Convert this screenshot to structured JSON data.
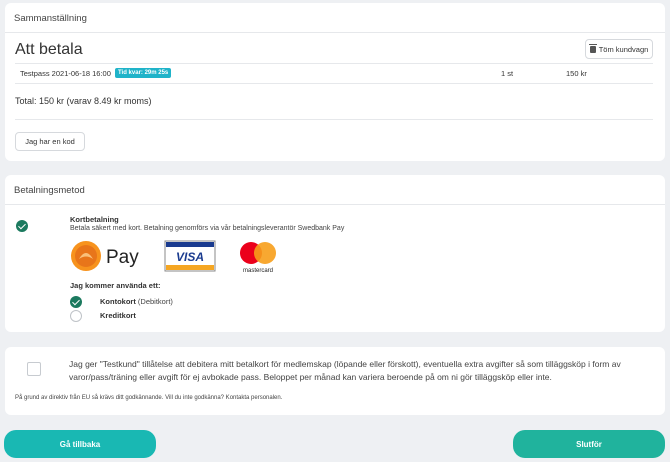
{
  "summary": {
    "header": "Sammanställning",
    "title": "Att betala",
    "clear_cart_label": "Töm kundvagn",
    "item": {
      "name": "Testpass 2021-06-18 16:00",
      "time_left_badge": "Tid kvar: 29m 25s",
      "quantity": "1 st",
      "price": "150 kr"
    },
    "total": "Total: 150 kr (varav 8.49 kr moms)",
    "code_button_label": "Jag har en kod"
  },
  "payment": {
    "header": "Betalningsmetod",
    "method_title": "Kortbetalning",
    "method_description": "Betala säkert med kort. Betalning genomförs via vår betalningsleverantör Swedbank Pay",
    "logos": {
      "swedbank_pay": "Pay",
      "visa": "VISA",
      "mastercard": "mastercard"
    },
    "will_use_label": "Jag kommer använda ett:",
    "options": [
      {
        "label": "Kontokort",
        "sublabel": "(Debitkort)",
        "selected": true
      },
      {
        "label": "Kreditkort",
        "sublabel": "",
        "selected": false
      }
    ]
  },
  "consent": {
    "text": "Jag ger \"Testkund\" tillåtelse att debitera mitt betalkort för medlemskap (löpande eller förskott), eventuella extra avgifter så som tilläggsköp i form av varor/pass/träning eller avgift för ej avbokade pass. Beloppet per månad kan variera beroende på om ni gör tilläggsköp eller inte.",
    "note": "På grund av direktiv från EU så krävs ditt godkännande. Vill du inte godkänna? Kontakta personalen.",
    "checked": false
  },
  "buttons": {
    "back_label": "Gå tillbaka",
    "finish_label": "Slutför"
  },
  "colors": {
    "accent": "#19b8b3",
    "check_green": "#1c7a5f",
    "badge": "#1fb3c9"
  }
}
